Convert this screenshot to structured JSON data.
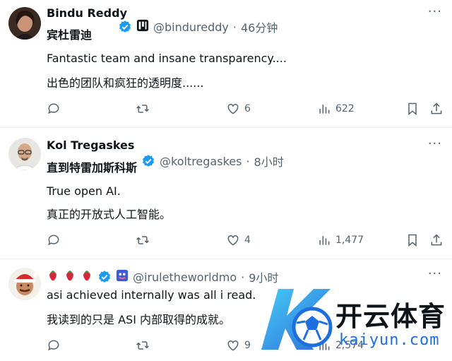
{
  "tweets": [
    {
      "name": "Bindu Reddy",
      "subname": "宾杜雷迪",
      "handle": "@bindureddy",
      "time": "46分钟",
      "sep": "·",
      "text1": "Fantastic team and insane transparency....",
      "text2": "出色的团队和疯狂的透明度......",
      "likes": "6",
      "views": "622"
    },
    {
      "name": "Kol Tregaskes",
      "subname": "直到特雷加斯科斯",
      "handle": "@koltregaskes",
      "time": "8小时",
      "sep": "·",
      "text1": "True open AI.",
      "text2": "真正的开放式人工智能。",
      "likes": "4",
      "views": "1,477"
    },
    {
      "handle": "@iruletheworldmo",
      "time": "9小时",
      "sep": "·",
      "text1": "asi achieved internally was all i read.",
      "text2": "我读到的只是 ASI 内部取得的成就。",
      "likes": "9",
      "views": "2,574"
    }
  ],
  "more_label": "···",
  "watermark": {
    "brand": "开云体育",
    "domain": "kaiyun.com"
  },
  "colors": {
    "text": "#0f1419",
    "muted": "#536471",
    "verified": "#1d9bf0",
    "divider": "#eff3f4"
  }
}
